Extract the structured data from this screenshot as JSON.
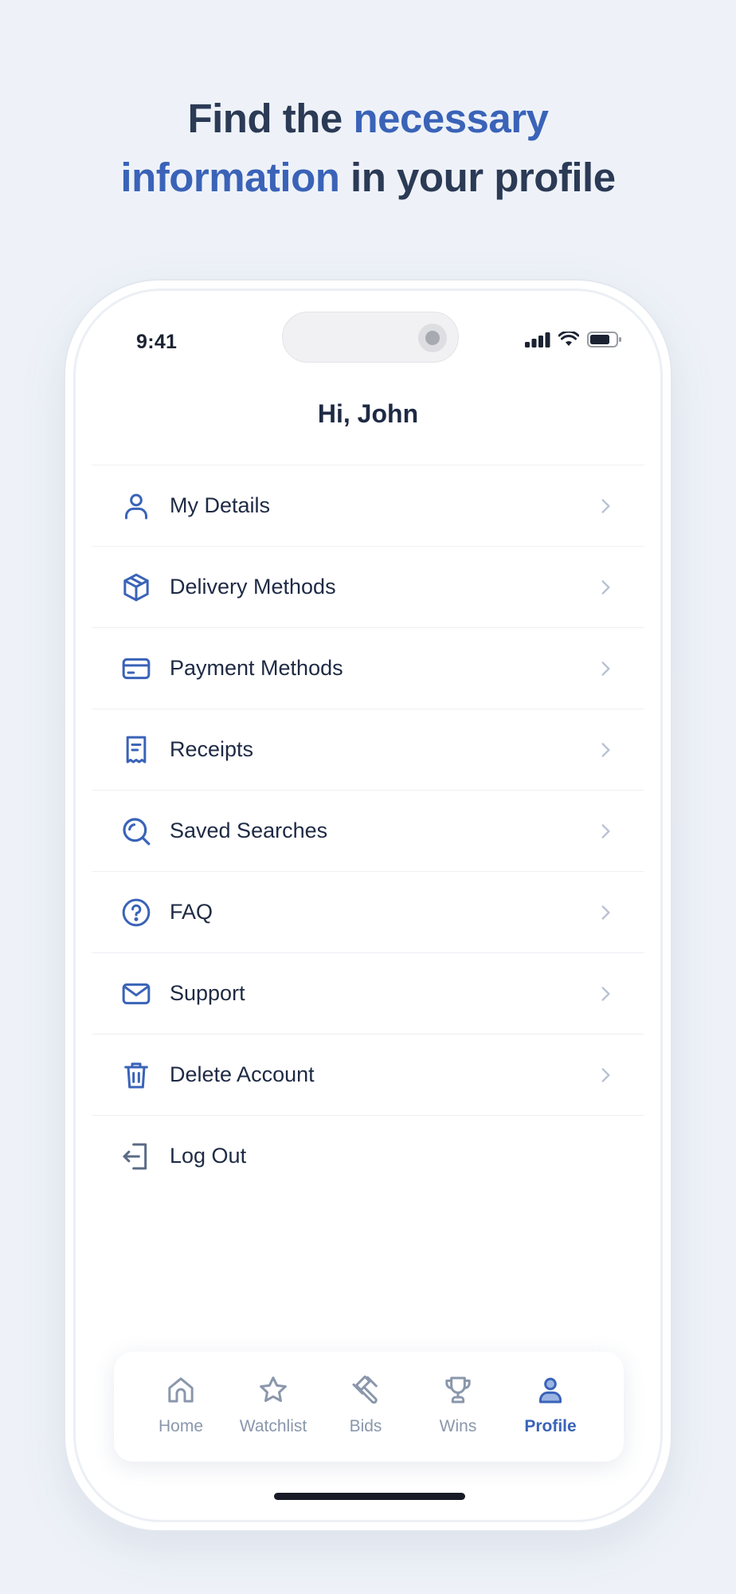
{
  "headline": {
    "part1": "Find the ",
    "accent1": "necessary",
    "accent2": "information",
    "part2": " in your profile"
  },
  "status_bar": {
    "time": "9:41"
  },
  "greeting": "Hi, John",
  "menu": [
    {
      "label": "My Details",
      "icon": "user-icon",
      "has_chevron": true
    },
    {
      "label": "Delivery Methods",
      "icon": "package-icon",
      "has_chevron": true
    },
    {
      "label": "Payment Methods",
      "icon": "credit-card-icon",
      "has_chevron": true
    },
    {
      "label": "Receipts",
      "icon": "receipt-icon",
      "has_chevron": true
    },
    {
      "label": "Saved Searches",
      "icon": "search-icon",
      "has_chevron": true
    },
    {
      "label": "FAQ",
      "icon": "help-circle-icon",
      "has_chevron": true
    },
    {
      "label": "Support",
      "icon": "mail-icon",
      "has_chevron": true
    },
    {
      "label": "Delete Account",
      "icon": "trash-icon",
      "has_chevron": true
    },
    {
      "label": "Log Out",
      "icon": "log-out-icon",
      "has_chevron": false
    }
  ],
  "tabs": [
    {
      "label": "Home",
      "icon": "home-icon",
      "active": false
    },
    {
      "label": "Watchlist",
      "icon": "star-icon",
      "active": false
    },
    {
      "label": "Bids",
      "icon": "gavel-icon",
      "active": false
    },
    {
      "label": "Wins",
      "icon": "trophy-icon",
      "active": false
    },
    {
      "label": "Profile",
      "icon": "user-icon",
      "active": true
    }
  ],
  "colors": {
    "accent": "#3a63b8",
    "text_dark": "#1e2a44",
    "inactive": "#8a97ab",
    "background": "#eef2f8"
  }
}
